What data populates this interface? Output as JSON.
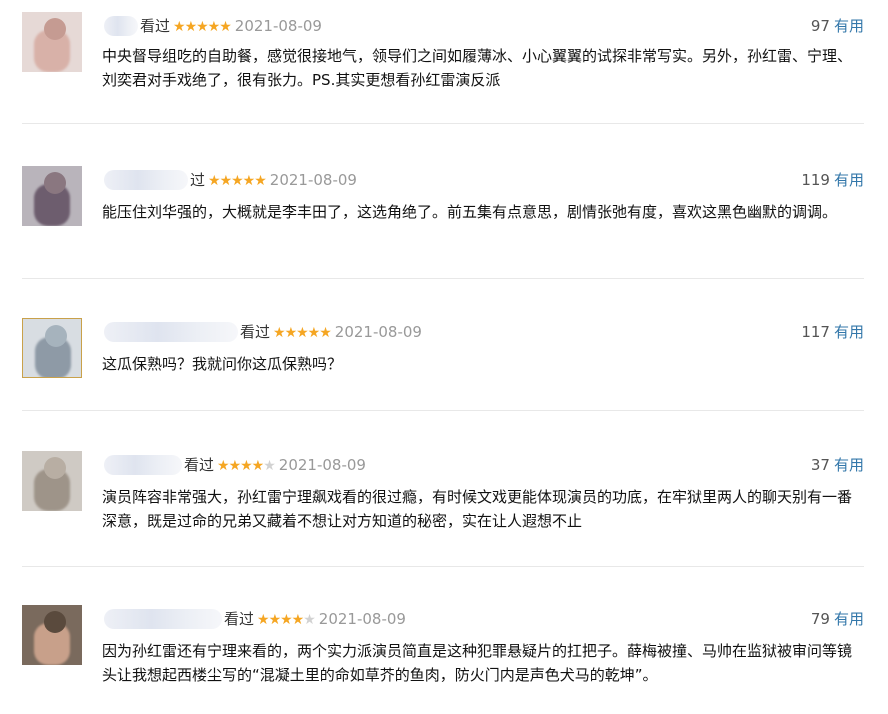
{
  "reviews": [
    {
      "seen": "看过",
      "rating": 5,
      "stars_text": "★★★★★",
      "date": "2021-08-09",
      "votes": "97",
      "useful": "有用",
      "content": "中央督导组吃的自助餐，感觉很接地气，领导们之间如履薄冰、小心翼翼的试探非常写实。另外，孙红雷、宁理、刘奕君对手戏绝了，很有张力。PS.其实更想看孙红雷演反派"
    },
    {
      "seen": "过",
      "rating": 5,
      "stars_text": "★★★★★",
      "date": "2021-08-09",
      "votes": "119",
      "useful": "有用",
      "content": "能压住刘华强的，大概就是李丰田了，这选角绝了。前五集有点意思，剧情张弛有度，喜欢这黑色幽默的调调。"
    },
    {
      "seen": "看过",
      "rating": 5,
      "stars_text": "★★★★★",
      "date": "2021-08-09",
      "votes": "117",
      "useful": "有用",
      "content": "这瓜保熟吗？我就问你这瓜保熟吗？"
    },
    {
      "seen": "看过",
      "rating": 4,
      "stars_text": "★★★★★",
      "date": "2021-08-09",
      "votes": "37",
      "useful": "有用",
      "content": "演员阵容非常强大，孙红雷宁理飙戏看的很过瘾，有时候文戏更能体现演员的功底，在牢狱里两人的聊天别有一番深意，既是过命的兄弟又藏着不想让对方知道的秘密，实在让人遐想不止"
    },
    {
      "seen": "看过",
      "rating": 4,
      "stars_text": "★★★★★",
      "date": "2021-08-09",
      "votes": "79",
      "useful": "有用",
      "content": "因为孙红雷还有宁理来看的，两个实力派演员简直是这种犯罪悬疑片的扛把子。薛梅被撞、马帅在监狱被审问等镜头让我想起西楼尘写的“混凝土里的命如草芥的鱼肉，防火门内是声色犬马的乾坤”。"
    }
  ],
  "colors": {
    "star_on": "#f5a623",
    "star_off": "#d2d2d2",
    "useful_link": "#3377aa",
    "date": "#999999"
  }
}
